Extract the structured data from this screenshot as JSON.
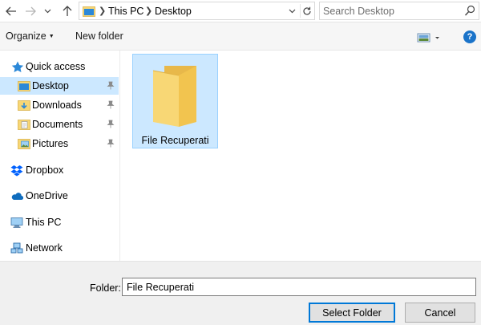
{
  "address_bar": {
    "back_icon": "arrow-left-icon",
    "forward_icon": "arrow-right-icon",
    "recent_icon": "chevron-down-icon",
    "up_icon": "arrow-up-icon",
    "crumbs": [
      "This PC",
      "Desktop"
    ],
    "refresh_icon": "refresh-icon"
  },
  "search": {
    "placeholder": "Search Desktop",
    "icon": "search-icon"
  },
  "toolbar": {
    "organize_label": "Organize",
    "new_folder_label": "New folder",
    "view_icon": "view-options-icon",
    "help_label": "?"
  },
  "nav": {
    "items": [
      {
        "label": "Quick access",
        "icon": "star-icon"
      },
      {
        "label": "Desktop",
        "icon": "desktop-folder-icon",
        "pinned": true,
        "selected": true
      },
      {
        "label": "Downloads",
        "icon": "downloads-icon",
        "pinned": true
      },
      {
        "label": "Documents",
        "icon": "documents-icon",
        "pinned": true
      },
      {
        "label": "Pictures",
        "icon": "pictures-icon",
        "pinned": true
      },
      {
        "label": "Dropbox",
        "icon": "dropbox-icon"
      },
      {
        "label": "OneDrive",
        "icon": "cloud-icon"
      },
      {
        "label": "This PC",
        "icon": "computer-icon"
      },
      {
        "label": "Network",
        "icon": "network-icon"
      }
    ]
  },
  "content": {
    "items": [
      {
        "label": "File Recuperati",
        "icon": "folder-icon",
        "selected": true
      }
    ]
  },
  "footer": {
    "folder_label": "Folder:",
    "folder_value": "File Recuperati",
    "select_label": "Select Folder",
    "cancel_label": "Cancel"
  },
  "colors": {
    "selection": "#cce8ff",
    "selection_border": "#99d1ff",
    "accent": "#0078d7",
    "folder_yellow": "#f8d775"
  }
}
